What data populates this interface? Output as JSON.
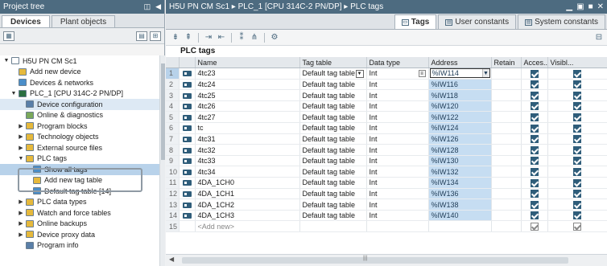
{
  "project_tree": {
    "title": "Project tree",
    "tabs": [
      {
        "label": "Devices",
        "active": true
      },
      {
        "label": "Plant objects",
        "active": false
      }
    ],
    "items": [
      {
        "label": "H5U PN CM Sc1",
        "indent": 0,
        "arrow": "▼",
        "icon_color": "#ffffff",
        "state": ""
      },
      {
        "label": "Add new device",
        "indent": 1,
        "arrow": "",
        "icon_color": "#e6b93c",
        "state": ""
      },
      {
        "label": "Devices & networks",
        "indent": 1,
        "arrow": "",
        "icon_color": "#4a8ec9",
        "state": ""
      },
      {
        "label": "PLC_1 [CPU 314C-2 PN/DP]",
        "indent": 1,
        "arrow": "▼",
        "icon_color": "#2a6f41",
        "state": ""
      },
      {
        "label": "Device configuration",
        "indent": 2,
        "arrow": "",
        "icon_color": "#5a7fa8",
        "state": "hl"
      },
      {
        "label": "Online & diagnostics",
        "indent": 2,
        "arrow": "",
        "icon_color": "#7aa85a",
        "state": ""
      },
      {
        "label": "Program blocks",
        "indent": 2,
        "arrow": "▶",
        "icon_color": "#e6b93c",
        "state": ""
      },
      {
        "label": "Technology objects",
        "indent": 2,
        "arrow": "▶",
        "icon_color": "#e6b93c",
        "state": ""
      },
      {
        "label": "External source files",
        "indent": 2,
        "arrow": "▶",
        "icon_color": "#e6b93c",
        "state": ""
      },
      {
        "label": "PLC tags",
        "indent": 2,
        "arrow": "▼",
        "icon_color": "#e6b93c",
        "state": ""
      },
      {
        "label": "Show all tags",
        "indent": 3,
        "arrow": "",
        "icon_color": "#4a8ec9",
        "state": "sel"
      },
      {
        "label": "Add new tag table",
        "indent": 3,
        "arrow": "",
        "icon_color": "#e6b93c",
        "state": ""
      },
      {
        "label": "Default tag table [14]",
        "indent": 3,
        "arrow": "",
        "icon_color": "#4a8ec9",
        "state": ""
      },
      {
        "label": "PLC data types",
        "indent": 2,
        "arrow": "▶",
        "icon_color": "#e6b93c",
        "state": ""
      },
      {
        "label": "Watch and force tables",
        "indent": 2,
        "arrow": "▶",
        "icon_color": "#e6b93c",
        "state": ""
      },
      {
        "label": "Online backups",
        "indent": 2,
        "arrow": "▶",
        "icon_color": "#e6b93c",
        "state": ""
      },
      {
        "label": "Device proxy data",
        "indent": 2,
        "arrow": "▶",
        "icon_color": "#e6b93c",
        "state": ""
      },
      {
        "label": "Program info",
        "indent": 2,
        "arrow": "",
        "icon_color": "#5a7fa8",
        "state": ""
      }
    ]
  },
  "editor": {
    "breadcrumb": "H5U PN CM Sc1 ▸ PLC_1 [CPU 314C-2 PN/DP] ▸ PLC tags",
    "tabs": [
      {
        "label": "Tags",
        "active": true,
        "icon": "tag-icon"
      },
      {
        "label": "User constants",
        "active": false,
        "icon": "constants-icon"
      },
      {
        "label": "System constants",
        "active": false,
        "icon": "system-constants-icon"
      }
    ],
    "section_title": "PLC tags",
    "columns": [
      "",
      "",
      "Name",
      "Tag table",
      "Data type",
      "Address",
      "Retain",
      "Acces...",
      "Visibl..."
    ],
    "rows": [
      {
        "num": "1",
        "name": "4tc23",
        "table": "Default tag table",
        "type": "Int",
        "address": "%IW114",
        "retain": false,
        "access": true,
        "visible": true
      },
      {
        "num": "2",
        "name": "4tc24",
        "table": "Default tag table",
        "type": "Int",
        "address": "%IW116",
        "retain": false,
        "access": true,
        "visible": true
      },
      {
        "num": "3",
        "name": "4tc25",
        "table": "Default tag table",
        "type": "Int",
        "address": "%IW118",
        "retain": false,
        "access": true,
        "visible": true
      },
      {
        "num": "4",
        "name": "4tc26",
        "table": "Default tag table",
        "type": "Int",
        "address": "%IW120",
        "retain": false,
        "access": true,
        "visible": true
      },
      {
        "num": "5",
        "name": "4tc27",
        "table": "Default tag table",
        "type": "Int",
        "address": "%IW122",
        "retain": false,
        "access": true,
        "visible": true
      },
      {
        "num": "6",
        "name": "tc",
        "table": "Default tag table",
        "type": "Int",
        "address": "%IW124",
        "retain": false,
        "access": true,
        "visible": true
      },
      {
        "num": "7",
        "name": "4tc31",
        "table": "Default tag table",
        "type": "Int",
        "address": "%IW126",
        "retain": false,
        "access": true,
        "visible": true
      },
      {
        "num": "8",
        "name": "4tc32",
        "table": "Default tag table",
        "type": "Int",
        "address": "%IW128",
        "retain": false,
        "access": true,
        "visible": true
      },
      {
        "num": "9",
        "name": "4tc33",
        "table": "Default tag table",
        "type": "Int",
        "address": "%IW130",
        "retain": false,
        "access": true,
        "visible": true
      },
      {
        "num": "10",
        "name": "4tc34",
        "table": "Default tag table",
        "type": "Int",
        "address": "%IW132",
        "retain": false,
        "access": true,
        "visible": true
      },
      {
        "num": "11",
        "name": "4DA_1CH0",
        "table": "Default tag table",
        "type": "Int",
        "address": "%IW134",
        "retain": false,
        "access": true,
        "visible": true
      },
      {
        "num": "12",
        "name": "4DA_1CH1",
        "table": "Default tag table",
        "type": "Int",
        "address": "%IW136",
        "retain": false,
        "access": true,
        "visible": true
      },
      {
        "num": "13",
        "name": "4DA_1CH2",
        "table": "Default tag table",
        "type": "Int",
        "address": "%IW138",
        "retain": false,
        "access": true,
        "visible": true
      },
      {
        "num": "14",
        "name": "4DA_1CH3",
        "table": "Default tag table",
        "type": "Int",
        "address": "%IW140",
        "retain": false,
        "access": true,
        "visible": true
      }
    ],
    "add_new_row": {
      "num": "15",
      "name": "<Add new>"
    }
  }
}
